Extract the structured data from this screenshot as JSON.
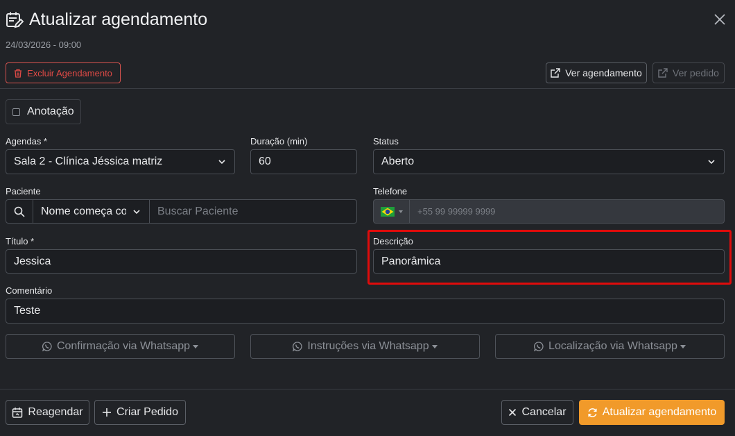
{
  "header": {
    "title": "Atualizar agendamento",
    "datetime": "24/03/2026 - 09:00"
  },
  "actions": {
    "delete_label": "Excluir Agendamento",
    "view_appointment_label": "Ver agendamento",
    "view_order_label": "Ver pedido"
  },
  "annotation": {
    "label": "Anotação",
    "checked": false
  },
  "form": {
    "agendas": {
      "label": "Agendas *",
      "value": "Sala 2 - Clínica Jéssica matriz"
    },
    "duracao": {
      "label": "Duração (min)",
      "value": "60"
    },
    "status": {
      "label": "Status",
      "value": "Aberto"
    },
    "paciente": {
      "label": "Paciente",
      "search_mode": "Nome começa com",
      "placeholder": "Buscar Paciente"
    },
    "telefone": {
      "label": "Telefone",
      "placeholder": "+55 99 99999 9999"
    },
    "titulo": {
      "label": "Título *",
      "value": "Jessica"
    },
    "descricao": {
      "label": "Descrição",
      "value": "Panorâmica"
    },
    "comentario": {
      "label": "Comentário",
      "value": "Teste"
    }
  },
  "whatsapp": {
    "confirmacao": "Confirmação via Whatsapp",
    "instrucoes": "Instruções via Whatsapp",
    "localizacao": "Localização via Whatsapp"
  },
  "footer": {
    "reagendar": "Reagendar",
    "criar_pedido": "Criar Pedido",
    "cancelar": "Cancelar",
    "atualizar": "Atualizar agendamento"
  },
  "colors": {
    "background": "#212327",
    "primary": "#f19a2a",
    "danger": "#e04a46",
    "highlight": "#e00b0b"
  },
  "icons": [
    "calendar-edit-icon",
    "close-icon",
    "trash-icon",
    "external-link-icon",
    "search-icon",
    "chevron-down-icon",
    "brazil-flag-icon",
    "whatsapp-icon",
    "calendar-icon",
    "plus-icon",
    "x-icon",
    "refresh-icon"
  ]
}
